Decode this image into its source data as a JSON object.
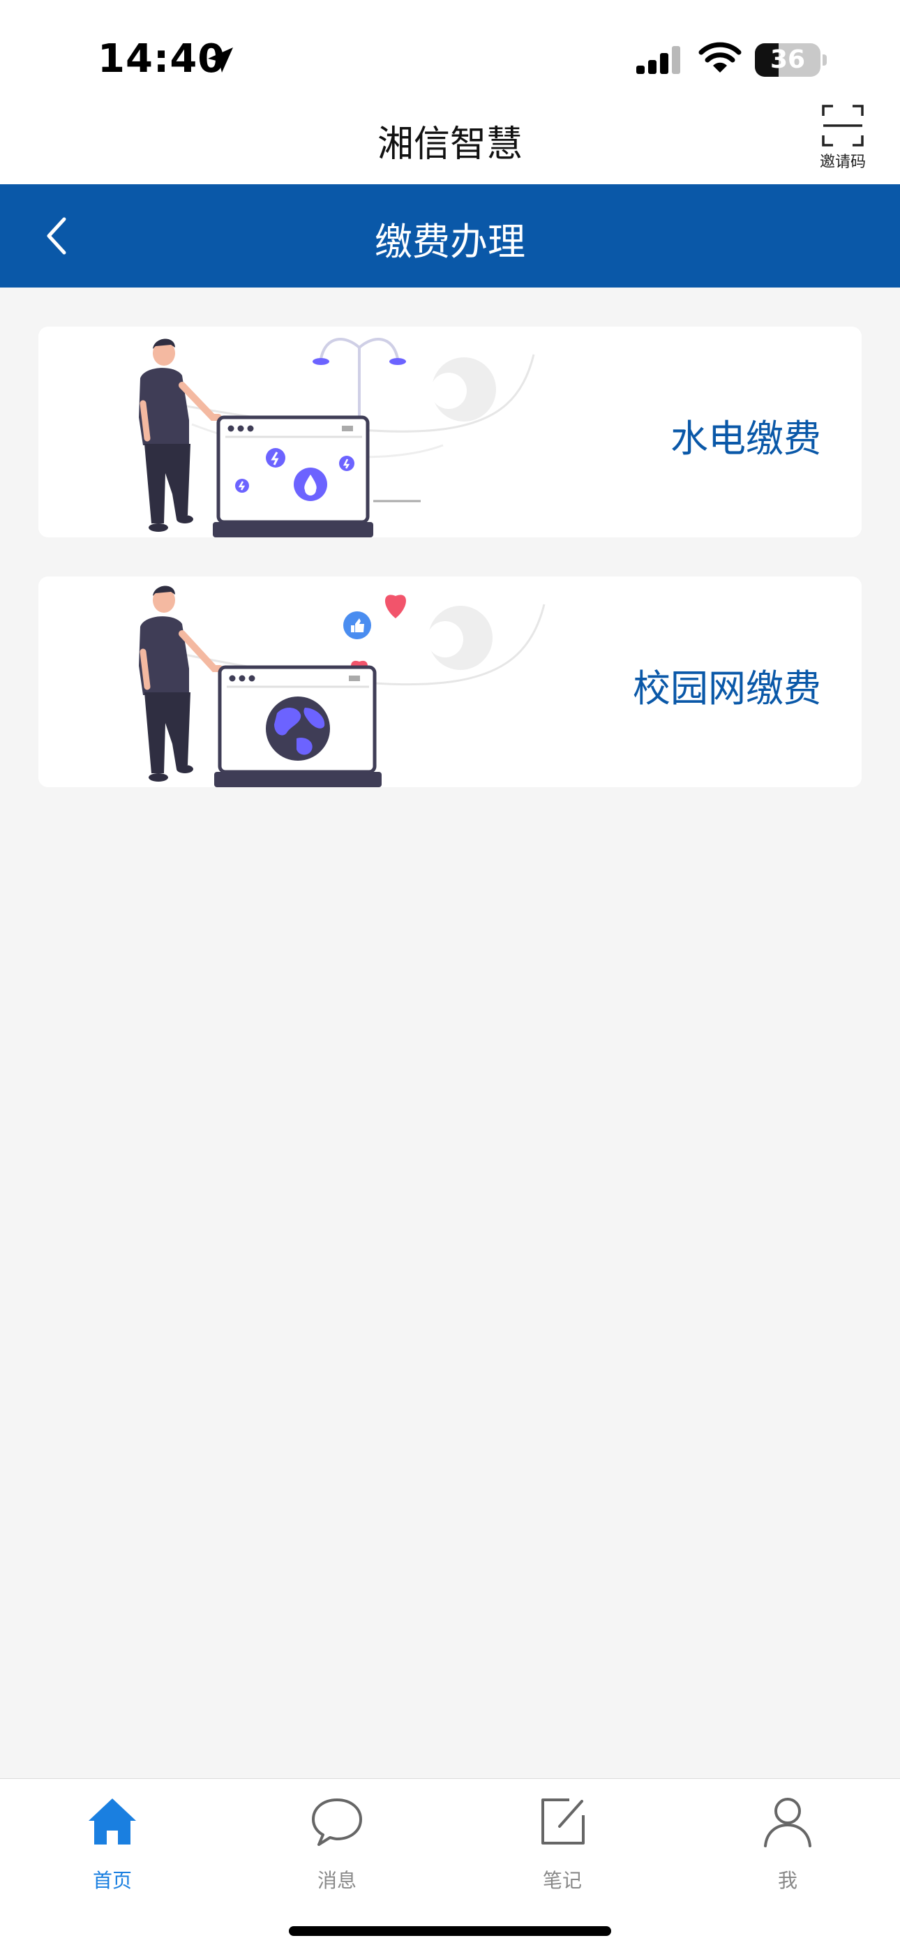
{
  "status_bar": {
    "time": "14:40",
    "battery_level": "36",
    "battery_fraction": 0.36
  },
  "app": {
    "title": "湘信智慧",
    "invite_label": "邀请码"
  },
  "nav": {
    "title": "缴费办理"
  },
  "cards": [
    {
      "label": "水电缴费",
      "icon": "laptop-water-electric-illustration"
    },
    {
      "label": "校园网缴费",
      "icon": "laptop-globe-illustration"
    }
  ],
  "tabbar": {
    "items": [
      {
        "label": "首页",
        "icon": "home-icon",
        "active": true
      },
      {
        "label": "消息",
        "icon": "chat-bubble-icon",
        "active": false
      },
      {
        "label": "笔记",
        "icon": "note-edit-icon",
        "active": false
      },
      {
        "label": "我",
        "icon": "person-icon",
        "active": false
      }
    ]
  },
  "colors": {
    "primary": "#0a58a8",
    "tab_active": "#1a7fe0",
    "tab_inactive": "#888888",
    "background": "#f5f5f5",
    "accent_purple": "#6c63ff",
    "heart": "#f2546b"
  }
}
